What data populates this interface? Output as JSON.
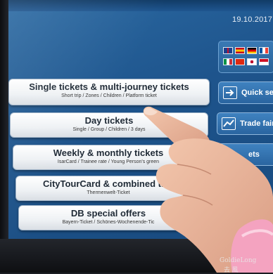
{
  "header": {
    "date": "19.10.2017"
  },
  "language_flags": [
    "gb-flag-icon",
    "es-flag-icon",
    "de-flag-icon",
    "fr-flag-icon",
    "it-flag-icon",
    "cn-flag-icon",
    "jp-flag-icon",
    "other-flag-icon"
  ],
  "menu": {
    "items": [
      {
        "title": "Single tickets & multi-journey tickets",
        "subtitle": "Short trip / Zones / Children / Platform ticket"
      },
      {
        "title": "Day tickets",
        "subtitle": "Single / Group / Children / 3 days"
      },
      {
        "title": "Weekly & monthly tickets",
        "subtitle": "IsarCard / Trainee rate / Young Person's green"
      },
      {
        "title": "CityTourCard & combined tick",
        "subtitle": "Thermenwelt-Ticket"
      },
      {
        "title": "DB special offers",
        "subtitle": "Bayern-Ticket / Schönes-Wochenende-Tic"
      }
    ]
  },
  "side_menu": {
    "quick_select": "Quick sel",
    "trade_fair": "Trade fair",
    "tickets": "ets"
  },
  "watermark": {
    "line1": "GoldieLong",
    "line2": "去 風"
  },
  "colors": {
    "screen": "#1e548c",
    "button": "#ffffff",
    "side_button": "#2f6ca7"
  }
}
